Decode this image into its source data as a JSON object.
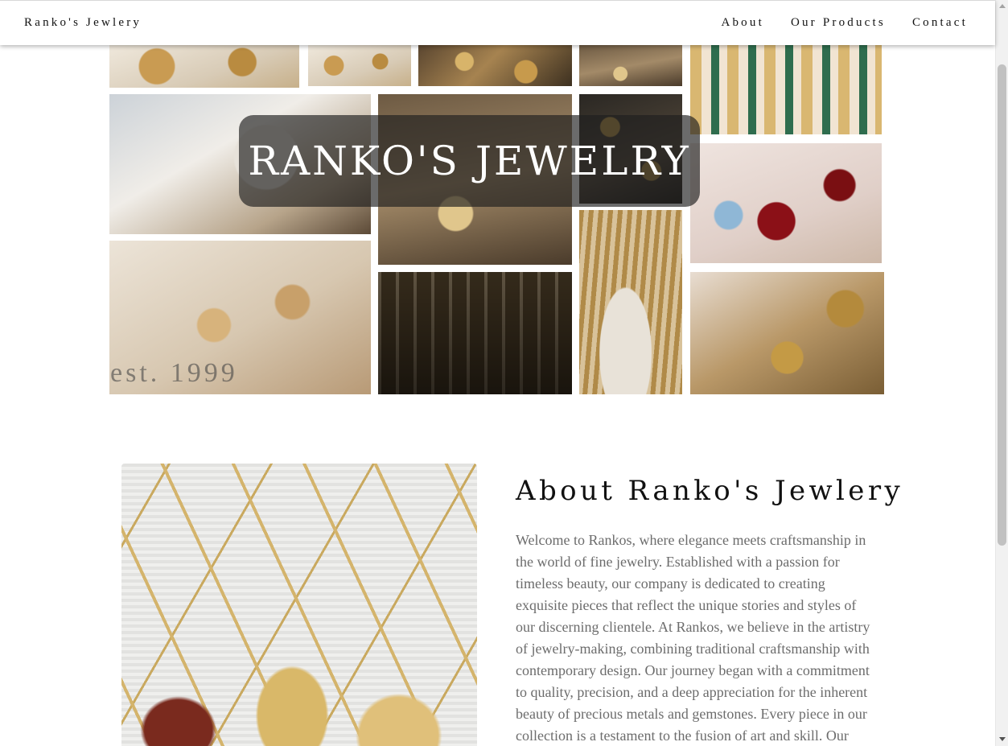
{
  "nav": {
    "brand": "Ranko's Jewlery",
    "links": [
      "About",
      "Our Products",
      "Contact"
    ]
  },
  "hero": {
    "title": "RANKO'S JEWELRY",
    "established": "est. 1999"
  },
  "collage": {
    "tiles": [
      "jewelry-photo",
      "jewelry-photo",
      "jewelry-photo",
      "jewelry-photo",
      "jewelry-photo",
      "jewelry-photo",
      "jewelry-photo",
      "jewelry-photo",
      "jewelry-photo",
      "jewelry-photo",
      "jewelry-photo",
      "jewelry-photo",
      "jewelry-photo",
      "jewelry-photo"
    ]
  },
  "about": {
    "heading": "About Ranko's Jewlery",
    "body": "Welcome to Rankos, where elegance meets craftsmanship in the world of fine jewelry. Established with a passion for timeless beauty, our company is dedicated to creating exquisite pieces that reflect the unique stories and styles of our discerning clientele. At Rankos, we believe in the artistry of jewelry-making, combining traditional craftsmanship with contemporary design. Our journey began with a commitment to quality, precision, and a deep appreciation for the inherent beauty of precious metals and gemstones. Every piece in our collection is a testament to the fusion of art and skill. Our"
  }
}
